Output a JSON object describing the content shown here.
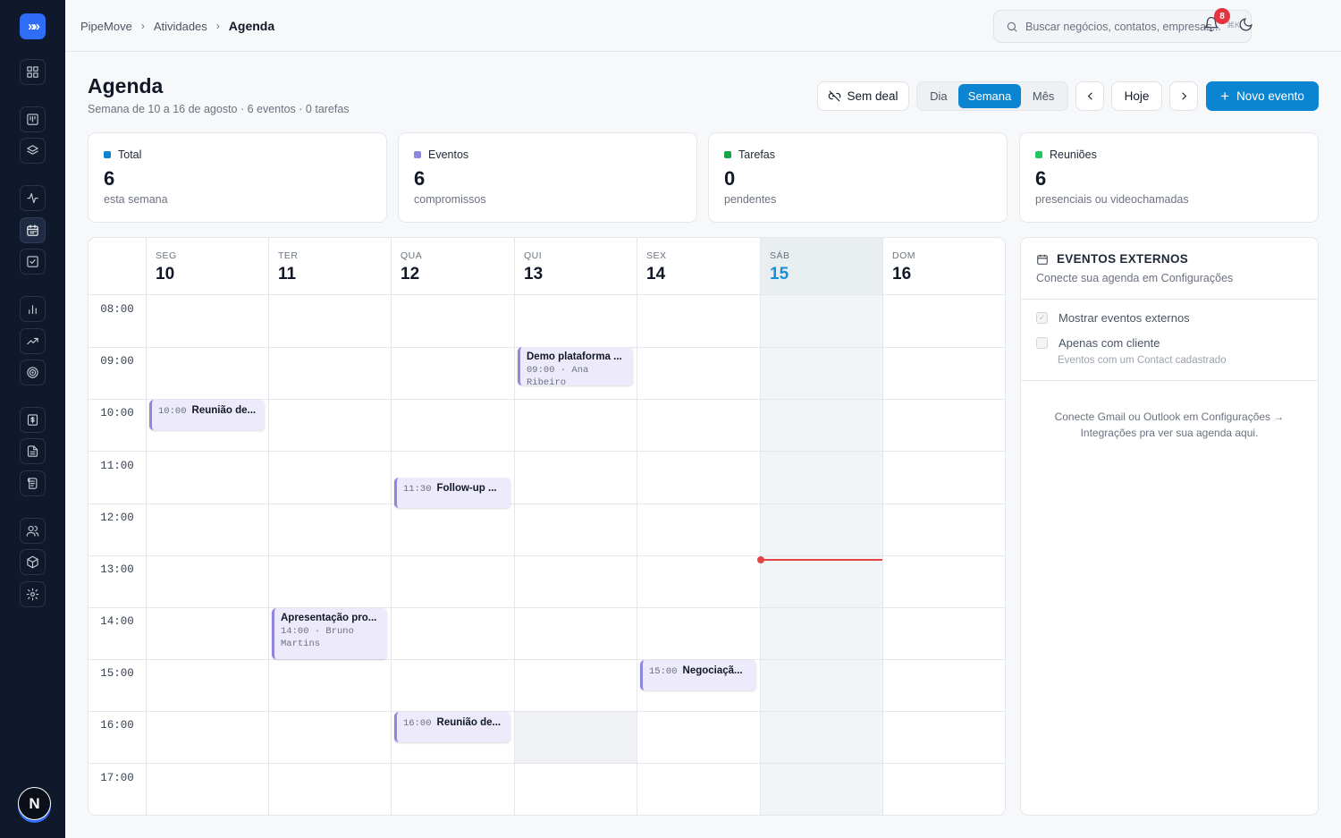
{
  "app": {
    "logo_glyph": "»»",
    "brand_color": "#2f6df6",
    "accent_color": "#0b84d1"
  },
  "sidebar": {
    "items": [
      {
        "name": "dashboard-icon"
      },
      {
        "name": "board-icon"
      },
      {
        "name": "layers-icon"
      },
      {
        "name": "activity-icon"
      },
      {
        "name": "calendar-icon",
        "active": true
      },
      {
        "name": "tasks-icon"
      },
      {
        "name": "bar-chart-icon"
      },
      {
        "name": "trending-icon"
      },
      {
        "name": "target-icon"
      },
      {
        "name": "money-icon"
      },
      {
        "name": "document-icon"
      },
      {
        "name": "contract-icon"
      },
      {
        "name": "users-icon"
      },
      {
        "name": "box-icon"
      },
      {
        "name": "gear-icon"
      }
    ],
    "avatar_initial": "N"
  },
  "topbar": {
    "breadcrumb": [
      "PipeMove",
      "Atividades",
      "Agenda"
    ],
    "search_placeholder": "Buscar negócios, contatos, empresas...",
    "search_shortcut": "⌘K",
    "notifications_count": "8"
  },
  "header": {
    "title": "Agenda",
    "subtitle": "Semana de 10 a 16 de agosto · 6 eventos · 0 tarefas",
    "no_deal_label": "Sem deal",
    "views": [
      "Dia",
      "Semana",
      "Mês"
    ],
    "active_view": "Semana",
    "today_label": "Hoje",
    "new_event_label": "Novo evento"
  },
  "stats": [
    {
      "label": "Total",
      "value": "6",
      "desc": "esta semana",
      "color": "#0b84d1"
    },
    {
      "label": "Eventos",
      "value": "6",
      "desc": "compromissos",
      "color": "#8f86de"
    },
    {
      "label": "Tarefas",
      "value": "0",
      "desc": "pendentes",
      "color": "#16a34a"
    },
    {
      "label": "Reuniões",
      "value": "6",
      "desc": "presenciais ou videochamadas",
      "color": "#22c55e"
    }
  ],
  "calendar": {
    "days": [
      {
        "name": "SEG",
        "date": "10"
      },
      {
        "name": "TER",
        "date": "11"
      },
      {
        "name": "QUA",
        "date": "12"
      },
      {
        "name": "QUI",
        "date": "13"
      },
      {
        "name": "SEX",
        "date": "14"
      },
      {
        "name": "SÁB",
        "date": "15",
        "today": true
      },
      {
        "name": "DOM",
        "date": "16"
      }
    ],
    "hours": [
      "08:00",
      "09:00",
      "10:00",
      "11:00",
      "12:00",
      "13:00",
      "14:00",
      "15:00",
      "16:00",
      "17:00"
    ],
    "events": [
      {
        "day": 3,
        "time": "09:00",
        "title": "Demo plataforma ...",
        "meta": "09:00 · Ana Ribeiro",
        "style": "stacked"
      },
      {
        "day": 0,
        "time": "10:00",
        "title": "Reunião de...",
        "style": "inline"
      },
      {
        "day": 2,
        "time": "11:30",
        "title": "Follow-up ...",
        "style": "inline"
      },
      {
        "day": 1,
        "time": "14:00",
        "title": "Apresentação pro...",
        "meta": "14:00 · Bruno Martins",
        "style": "stacked"
      },
      {
        "day": 4,
        "time": "15:00",
        "title": "Negociaçã...",
        "style": "inline"
      },
      {
        "day": 2,
        "time": "16:00",
        "title": "Reunião de...",
        "style": "inline"
      }
    ],
    "now_color": "#e64545"
  },
  "external": {
    "title": "EVENTOS EXTERNOS",
    "subtitle": "Conecte sua agenda em Configurações",
    "show_external_label": "Mostrar eventos externos",
    "client_only_label": "Apenas com cliente",
    "client_only_hint": "Eventos com um Contact cadastrado",
    "note": "Conecte Gmail ou Outlook em Configurações → Integrações pra ver sua agenda aqui."
  }
}
